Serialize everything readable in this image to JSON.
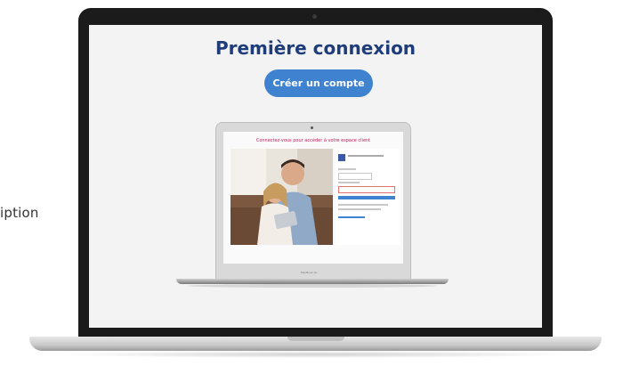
{
  "side_text": "iption",
  "screen": {
    "heading": "Première connexion",
    "create_account_button": "Créer un compte"
  },
  "inner_screen": {
    "title": "Connectez-vous pour accéder à votre espace client",
    "photo_subject": "couple-with-tablet-on-sofa",
    "laptop_label": "MacBook Air"
  },
  "colors": {
    "heading": "#1f3d7a",
    "button": "#3f82cf",
    "inner_title": "#c2185b",
    "bezel": "#1b1b1b"
  }
}
